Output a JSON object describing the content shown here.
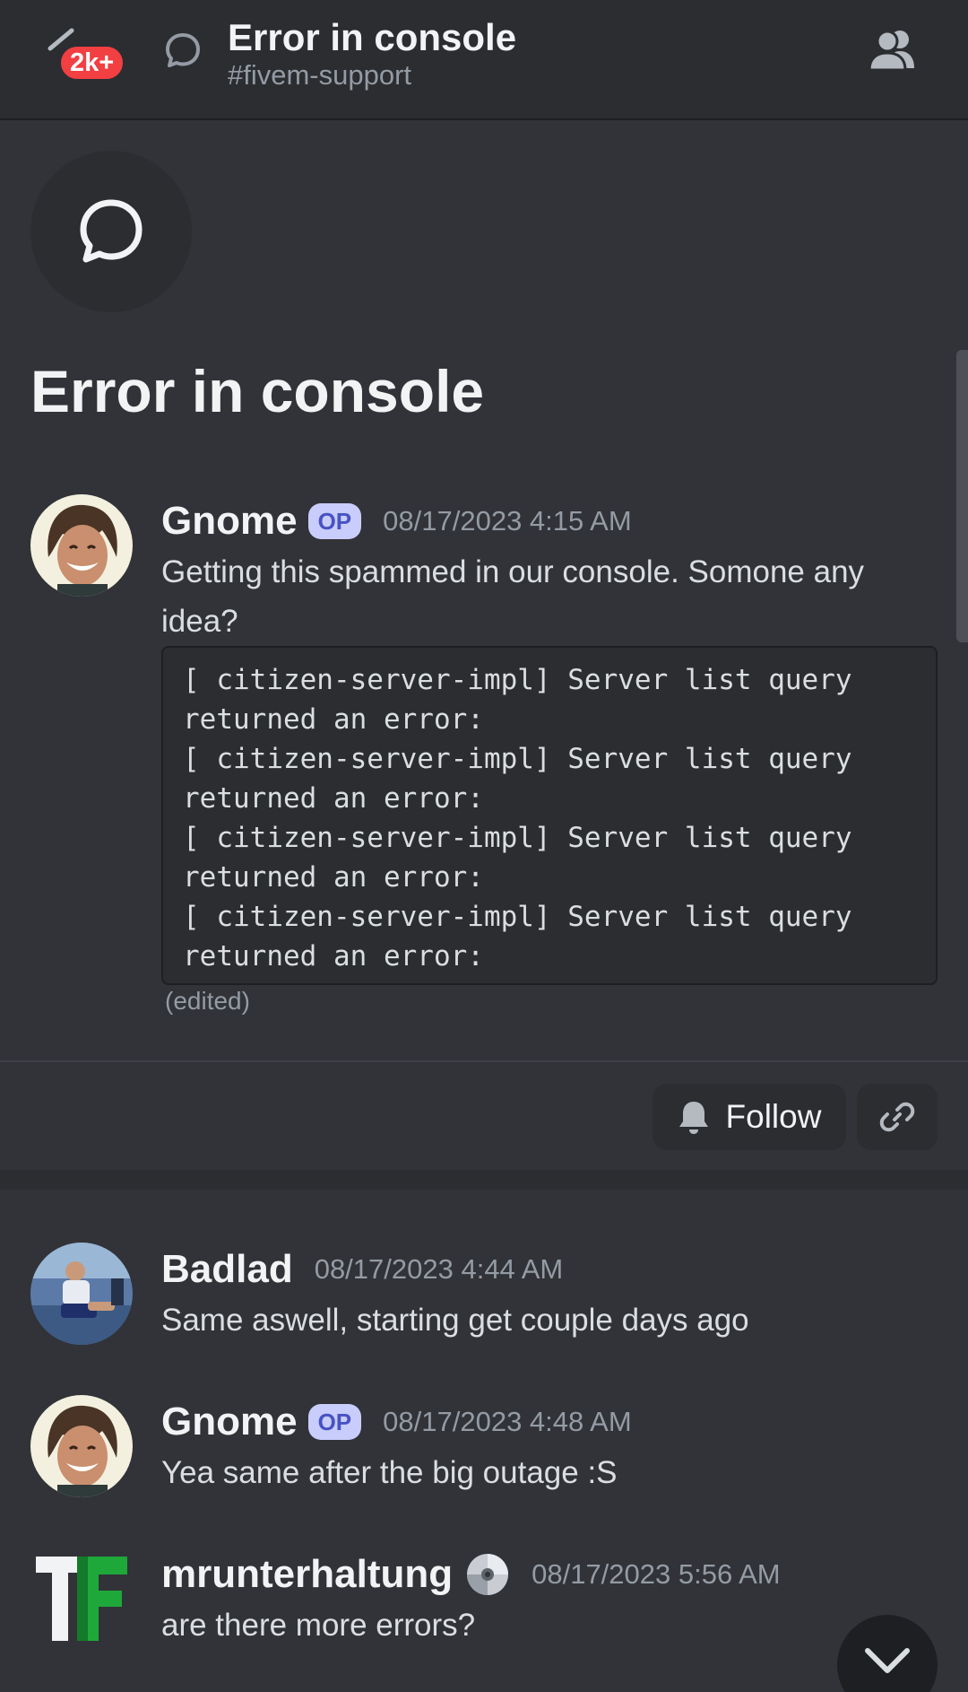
{
  "header": {
    "notification_badge": "2k+",
    "title": "Error in console",
    "channel": "#fivem-support"
  },
  "thread": {
    "title": "Error in console"
  },
  "original_post": {
    "username": "Gnome",
    "op_tag": "OP",
    "timestamp": "08/17/2023 4:15 AM",
    "text_line1": "Getting this spammed in our console. Somone any",
    "text_line2": "idea?",
    "code": "[ citizen-server-impl] Server list query\nreturned an error:\n[ citizen-server-impl] Server list query\nreturned an error:\n[ citizen-server-impl] Server list query\nreturned an error:\n[ citizen-server-impl] Server list query\nreturned an error:",
    "edited_label": "(edited)"
  },
  "actions": {
    "follow_label": "Follow"
  },
  "messages": [
    {
      "username": "Badlad",
      "timestamp": "08/17/2023 4:44 AM",
      "text": "Same aswell, starting get couple days ago"
    },
    {
      "username": "Gnome",
      "op_tag": "OP",
      "timestamp": "08/17/2023 4:48 AM",
      "text": "Yea same after the big outage :S"
    },
    {
      "username": "mrunterhaltung",
      "timestamp": "08/17/2023 5:56 AM",
      "text": "are there more errors?"
    }
  ],
  "colors": {
    "background": "#313338",
    "header_bg": "#2b2d31",
    "badge": "#f23f42",
    "op_tag_bg": "#c9cdfb",
    "op_tag_text": "#4752c4"
  }
}
